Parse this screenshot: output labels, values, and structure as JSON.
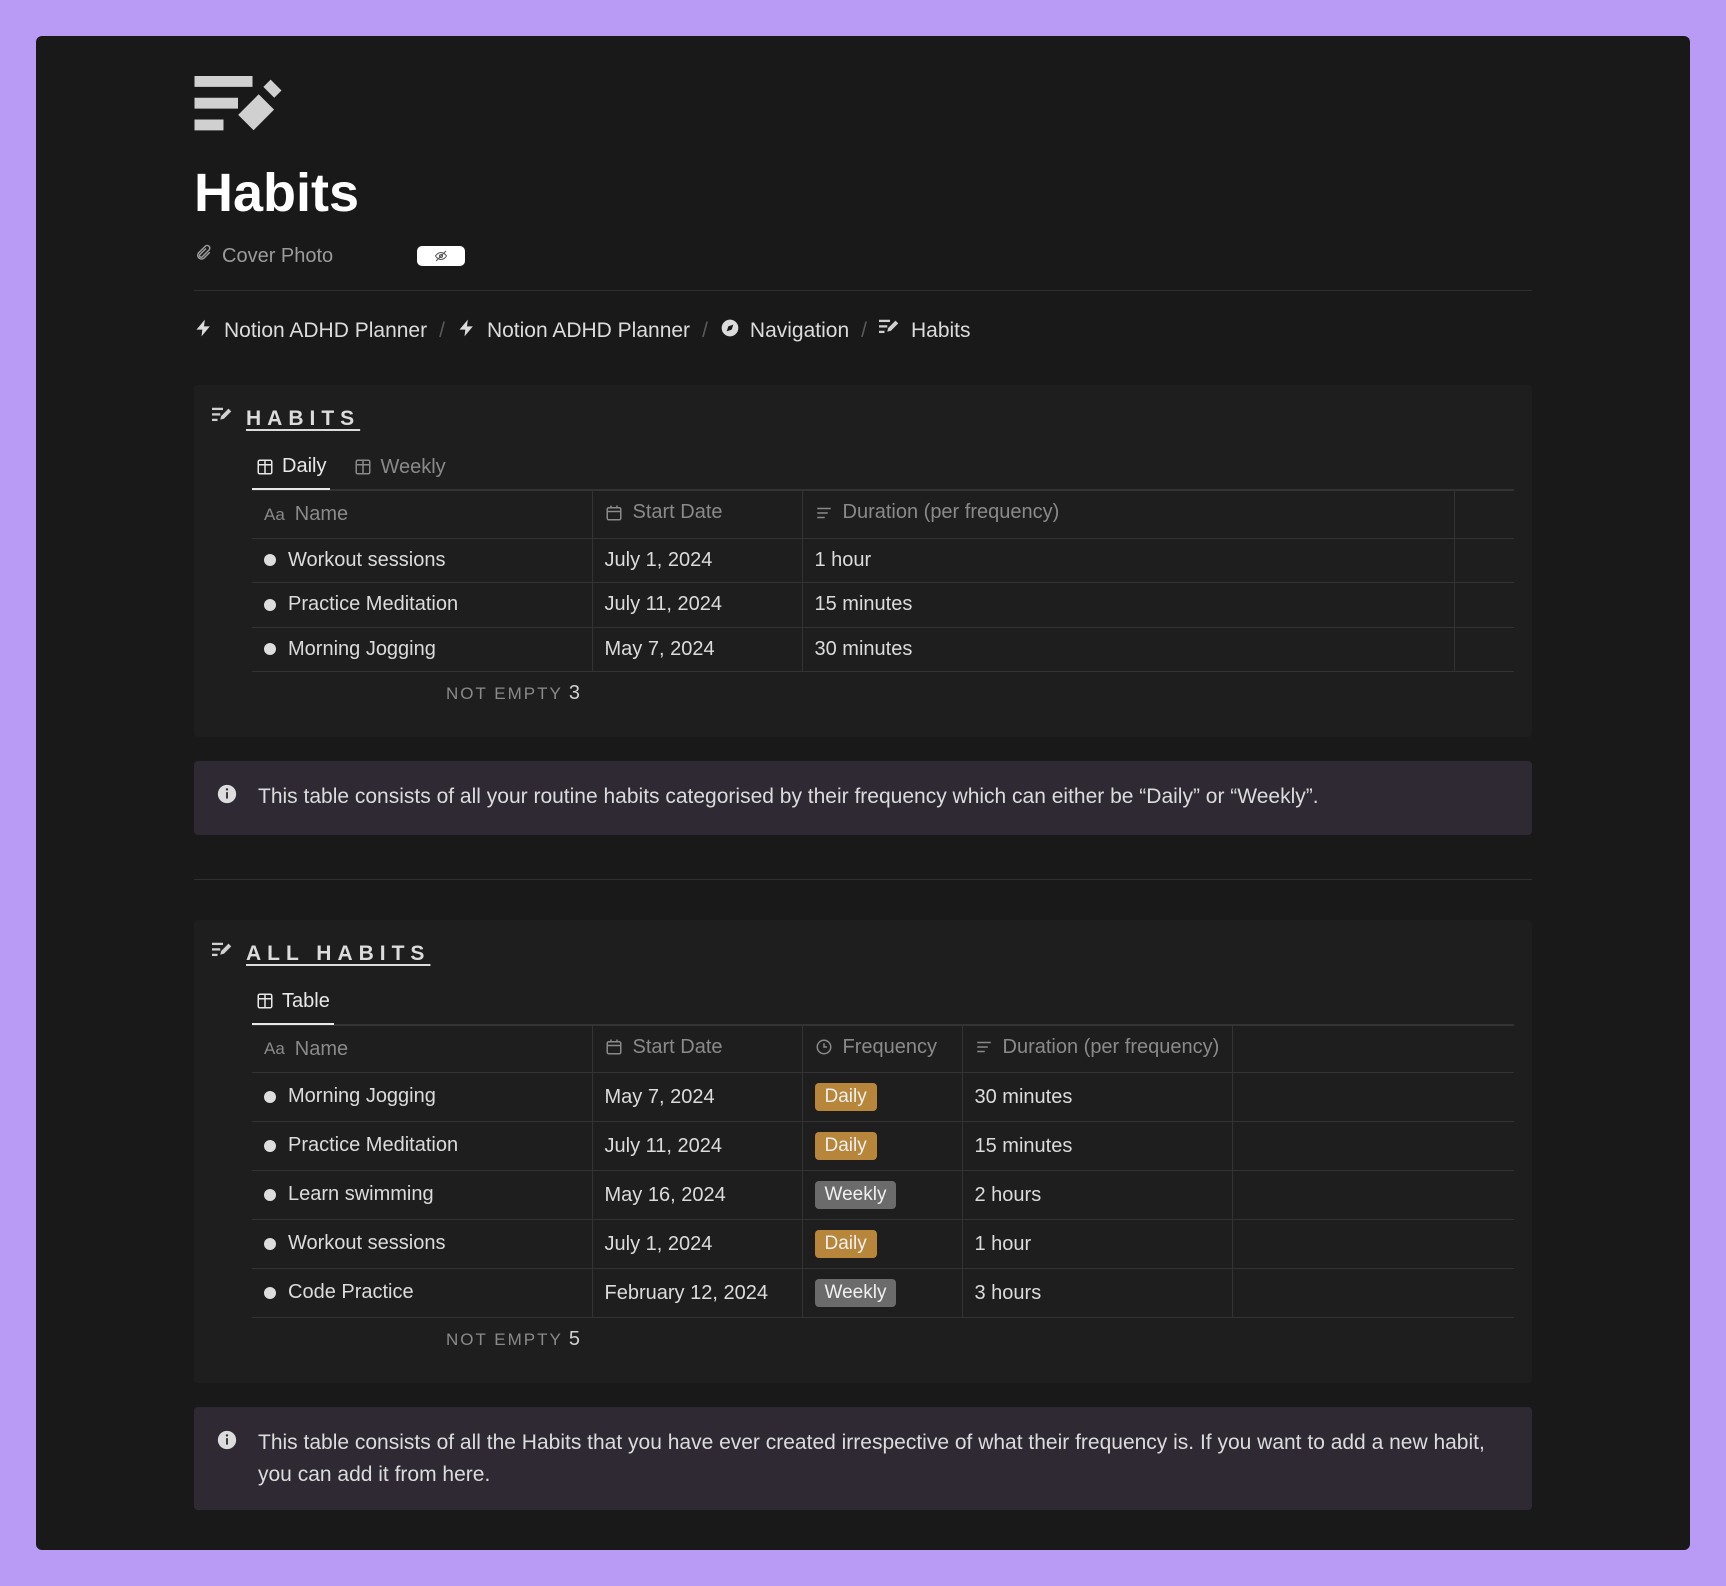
{
  "page": {
    "title": "Habits",
    "cover_link": "Cover Photo"
  },
  "breadcrumb": {
    "items": [
      {
        "label": "Notion ADHD Planner"
      },
      {
        "label": "Notion ADHD Planner"
      },
      {
        "label": "Navigation"
      },
      {
        "label": "Habits"
      }
    ]
  },
  "section_habits": {
    "title": "HABITS",
    "tabs": {
      "daily": "Daily",
      "weekly": "Weekly"
    },
    "columns": {
      "name": "Name",
      "start_date": "Start Date",
      "duration": "Duration (per frequency)"
    },
    "rows": [
      {
        "name": "Workout sessions",
        "start_date": "July 1, 2024",
        "duration": "1 hour"
      },
      {
        "name": "Practice Meditation",
        "start_date": "July 11, 2024",
        "duration": "15 minutes"
      },
      {
        "name": "Morning Jogging",
        "start_date": "May 7, 2024",
        "duration": "30 minutes"
      }
    ],
    "footer_label": "NOT EMPTY",
    "footer_count": "3"
  },
  "callout_habits": "This table consists of all your routine habits categorised by their frequency which can either be “Daily” or “Weekly”.",
  "section_all": {
    "title": "ALL HABITS",
    "tabs": {
      "table": "Table"
    },
    "columns": {
      "name": "Name",
      "start_date": "Start Date",
      "frequency": "Frequency",
      "duration": "Duration (per frequency)"
    },
    "rows": [
      {
        "name": "Morning Jogging",
        "start_date": "May 7, 2024",
        "frequency": "Daily",
        "duration": "30 minutes"
      },
      {
        "name": "Practice Meditation",
        "start_date": "July 11, 2024",
        "frequency": "Daily",
        "duration": "15 minutes"
      },
      {
        "name": "Learn swimming",
        "start_date": "May 16, 2024",
        "frequency": "Weekly",
        "duration": "2 hours"
      },
      {
        "name": "Workout sessions",
        "start_date": "July 1, 2024",
        "frequency": "Daily",
        "duration": "1 hour"
      },
      {
        "name": "Code Practice",
        "start_date": "February 12, 2024",
        "frequency": "Weekly",
        "duration": "3 hours"
      }
    ],
    "footer_label": "NOT EMPTY",
    "footer_count": "5"
  },
  "callout_all": "This table consists of all the Habits that you have ever created irrespective of what their frequency is. If you want to add a new habit, you can add it from here.",
  "colors": {
    "accent_purple": "#b99bf5",
    "bg_dark": "#191919",
    "tag_daily": "#b8863a",
    "tag_weekly": "#6b6b6b",
    "callout_bg": "#2e2933"
  }
}
